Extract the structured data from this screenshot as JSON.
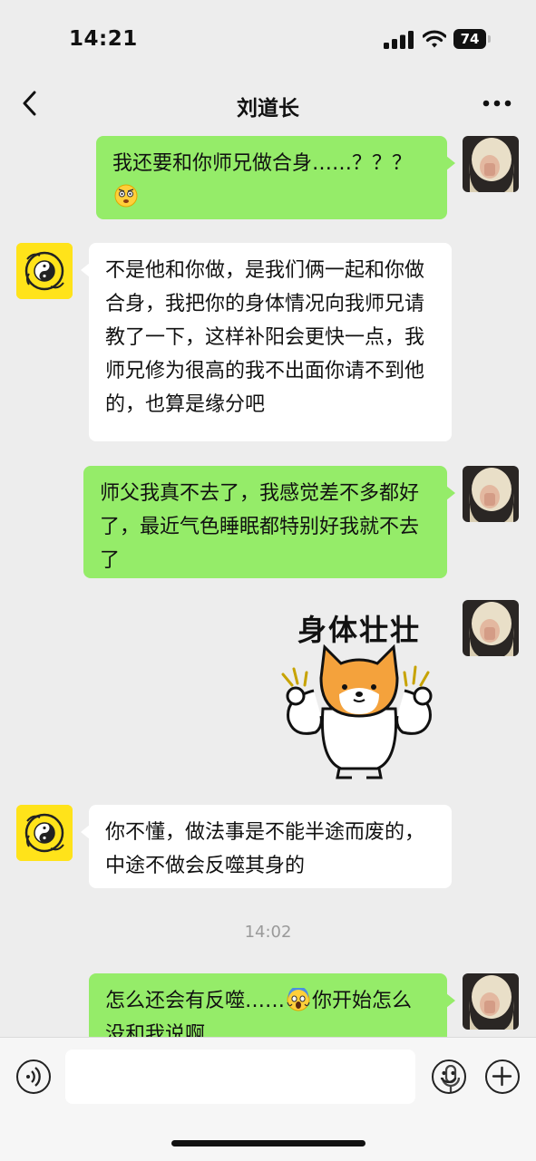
{
  "status_bar": {
    "time": "14:21",
    "battery": "74"
  },
  "header": {
    "title": "刘道长"
  },
  "messages": [
    {
      "sender": "self",
      "text": "我还要和你师兄做合身……？？？",
      "emoji": "stunned-face"
    },
    {
      "sender": "other",
      "text": "不是他和你做，是我们俩一起和你做合身，我把你的身体情况向我师兄请教了一下，这样补阳会更快一点，我师兄修为很高的我不出面你请不到他的，也算是缘分吧"
    },
    {
      "sender": "self",
      "text": "师父我真不去了，我感觉差不多都好了，最近气色睡眠都特别好我就不去了"
    },
    {
      "sender": "self",
      "type": "sticker",
      "caption": "身体壮壮"
    },
    {
      "sender": "other",
      "text": "你不懂，做法事是不能半途而废的，中途不做会反噬其身的"
    },
    {
      "sender": "self",
      "text_before": "怎么还会有反噬……",
      "emoji": "screaming-face",
      "text_after": "你开始怎么没和我说啊"
    }
  ],
  "timestamp": "14:02",
  "colors": {
    "self_bubble": "#95ec69",
    "other_bubble": "#ffffff",
    "background": "#ededed",
    "other_avatar": "#ffe31a"
  },
  "icons": [
    "back-icon",
    "more-icon",
    "voice-icon",
    "mic-icon",
    "emoji-icon",
    "add-icon"
  ]
}
